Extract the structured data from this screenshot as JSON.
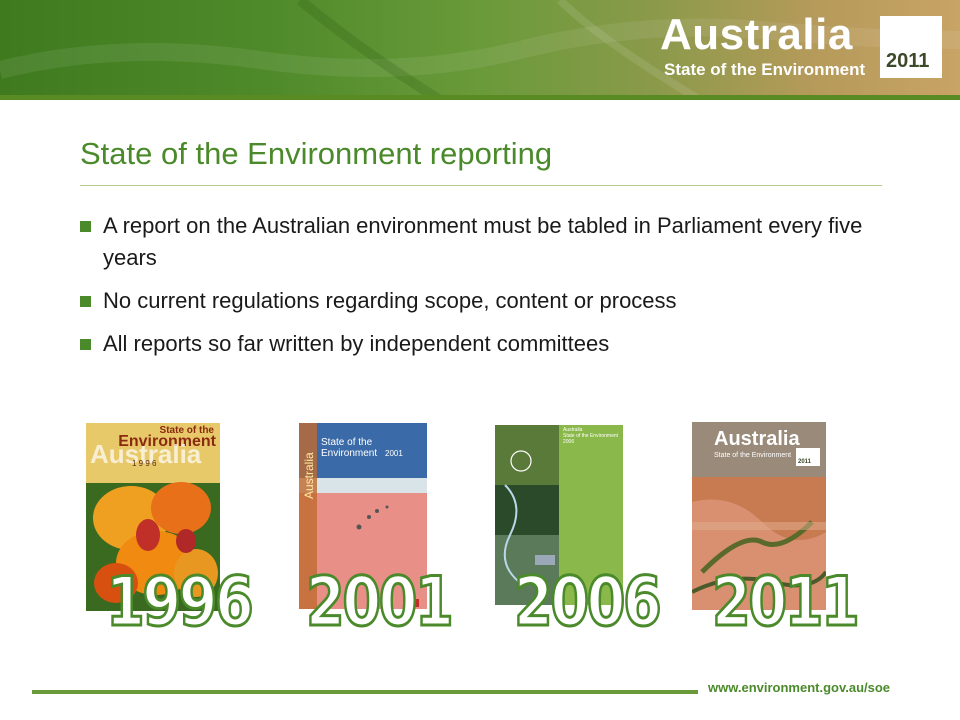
{
  "header": {
    "logo_word": "Australia",
    "logo_subtitle": "State of the Environment",
    "logo_year": "2011"
  },
  "slide": {
    "title": "State of the Environment reporting",
    "bullets": [
      "A report on the Australian environment must be tabled in Parliament every five years",
      "No current regulations regarding scope, content or process",
      "All reports so far written by independent committees"
    ]
  },
  "reports": [
    {
      "year": "1996",
      "cover_title_line1": "State of the",
      "cover_title_line2": "Environment",
      "cover_brand": "Australia",
      "cover_year": "1 9 9 6"
    },
    {
      "year": "2001",
      "cover_title": "State of the Environment",
      "cover_year": "2001",
      "cover_brand": "Australia"
    },
    {
      "year": "2006",
      "cover_brand": "Australia",
      "cover_title": "State of the Environment",
      "cover_year": "2006"
    },
    {
      "year": "2011",
      "cover_brand": "Australia",
      "cover_title": "State of the Environment",
      "cover_year": "2011"
    }
  ],
  "footer": {
    "url": "www.environment.gov.au/soe"
  },
  "colors": {
    "accent": "#4a8a2a",
    "rule": "#6a9a3a",
    "text": "#1a1a1a"
  }
}
